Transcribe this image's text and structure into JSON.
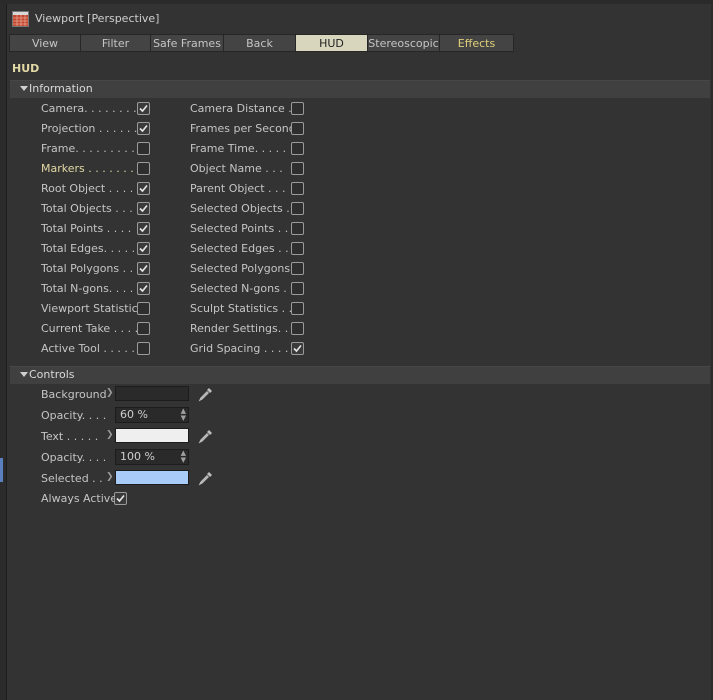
{
  "window": {
    "title": "Viewport [Perspective]"
  },
  "tabs": [
    {
      "label": "View"
    },
    {
      "label": "Filter"
    },
    {
      "label": "Safe Frames"
    },
    {
      "label": "Back"
    },
    {
      "label": "HUD",
      "active": true
    },
    {
      "label": "Stereoscopic"
    },
    {
      "label": "Effects"
    }
  ],
  "hud": {
    "title": "HUD"
  },
  "information": {
    "title": "Information",
    "left": [
      {
        "label": "Camera. . . . . . . . .",
        "checked": true
      },
      {
        "label": "Projection . . . . . .",
        "checked": true
      },
      {
        "label": "Frame. . . . . . . . .",
        "checked": false
      },
      {
        "label": "Markers . . . . . . .",
        "checked": false
      },
      {
        "label": "Root Object . . . .",
        "checked": true
      },
      {
        "label": "Total Objects . . .",
        "checked": true
      },
      {
        "label": "Total Points . . . .",
        "checked": true
      },
      {
        "label": "Total Edges. . . . .",
        "checked": true
      },
      {
        "label": "Total Polygons . .",
        "checked": true
      },
      {
        "label": "Total N-gons. . . .",
        "checked": true
      },
      {
        "label": "Viewport Statistics",
        "checked": false
      },
      {
        "label": "Current Take . . . .",
        "checked": false
      },
      {
        "label": "Active Tool . . . . .",
        "checked": false
      }
    ],
    "right": [
      {
        "label": "Camera Distance .",
        "checked": false
      },
      {
        "label": "Frames per Second",
        "checked": false
      },
      {
        "label": "Frame Time. . . . .",
        "checked": false
      },
      {
        "label": "Object Name . . .",
        "checked": false
      },
      {
        "label": "Parent Object . . .",
        "checked": false
      },
      {
        "label": "Selected Objects .",
        "checked": false
      },
      {
        "label": "Selected Points . .",
        "checked": false
      },
      {
        "label": "Selected Edges . .",
        "checked": false
      },
      {
        "label": "Selected Polygons",
        "checked": false
      },
      {
        "label": "Selected N-gons .",
        "checked": false
      },
      {
        "label": "Sculpt Statistics . .",
        "checked": false
      },
      {
        "label": "Render Settings. .",
        "checked": false
      },
      {
        "label": "Grid Spacing . . . .",
        "checked": true
      }
    ]
  },
  "controls": {
    "title": "Controls",
    "background_label": "Background",
    "background_color": "#2a2a2a",
    "opacity1_label": "Opacity. . . .",
    "opacity1_value": "60 %",
    "text_label": "Text . . . . .",
    "text_color": "#efefef",
    "opacity2_label": "Opacity. . . .",
    "opacity2_value": "100 %",
    "selected_label": "Selected . .",
    "selected_color": "#a8cbf7",
    "always_active_label": "Always Active",
    "always_active_checked": true
  }
}
